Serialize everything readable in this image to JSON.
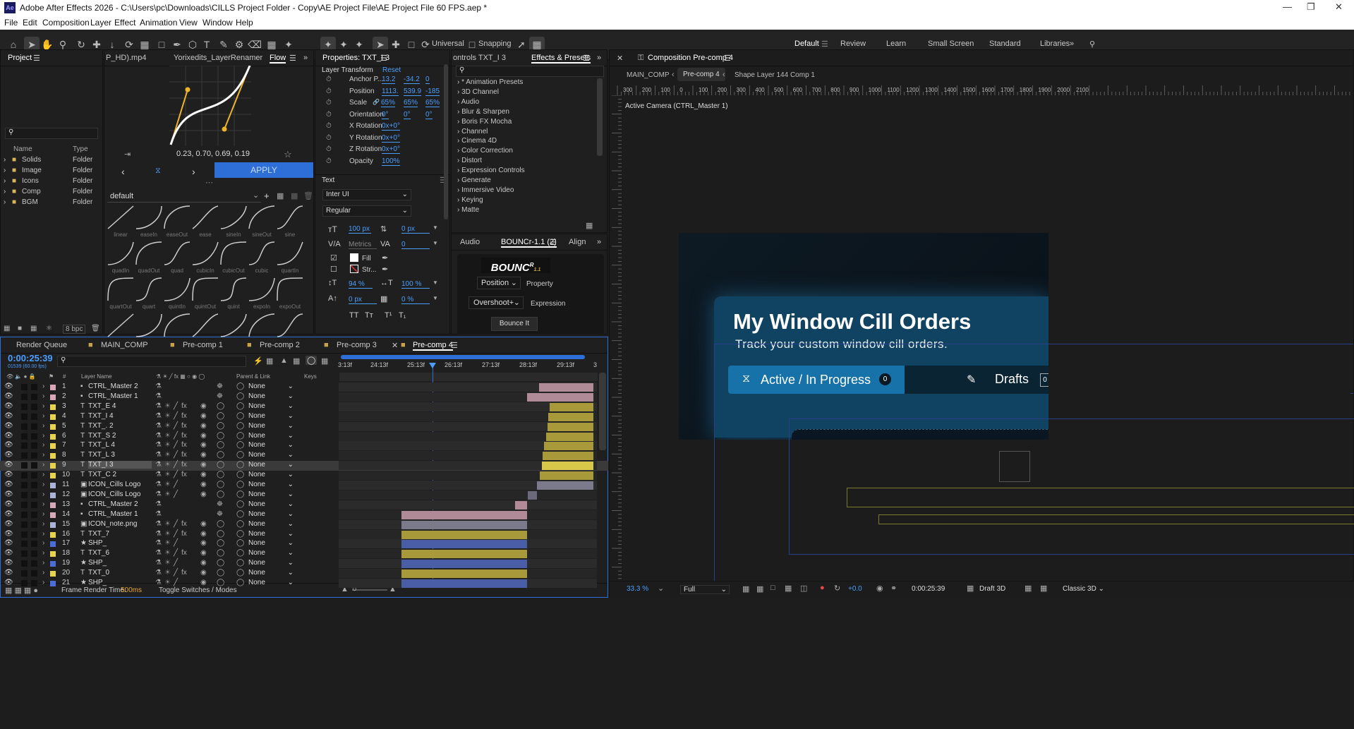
{
  "titlebar": {
    "app_icon": "Ae",
    "title": "Adobe After Effects 2026 - C:\\Users\\pc\\Downloads\\CILLS Project Folder - Copy\\AE Project File\\AE Project File 60 FPS.aep *"
  },
  "menu": [
    "File",
    "Edit",
    "Composition",
    "Layer",
    "Effect",
    "Animation",
    "View",
    "Window",
    "Help"
  ],
  "toolbar": {
    "universal_label": "Universal",
    "snapping_label": "Snapping",
    "workspaces": [
      "Default",
      "Review",
      "Learn",
      "Small Screen",
      "Standard",
      "Libraries"
    ]
  },
  "project": {
    "tab": "Project",
    "col_name": "Name",
    "col_type": "Type",
    "items": [
      {
        "name": "Solids",
        "type": "Folder"
      },
      {
        "name": "Image",
        "type": "Folder"
      },
      {
        "name": "Icons",
        "type": "Folder"
      },
      {
        "name": "Comp",
        "type": "Folder"
      },
      {
        "name": "BGM",
        "type": "Folder"
      }
    ],
    "bpc": "8 bpc"
  },
  "flow": {
    "tabs": [
      "P_HD).mp4",
      "Yorixedits_LayerRenamer",
      "Flow"
    ],
    "values": "0.23, 0.70, 0.69, 0.19",
    "apply": "APPLY",
    "preset": "default",
    "easings": [
      "linear",
      "easeIn",
      "easeOut",
      "ease",
      "sineIn",
      "sineOut",
      "sine",
      "quadIn",
      "quadOut",
      "quad",
      "cubicIn",
      "cubicOut",
      "cubic",
      "quartIn",
      "quartOut",
      "quart",
      "quintIn",
      "quintOut",
      "quint",
      "expoIn",
      "expoOut"
    ]
  },
  "properties": {
    "tab": "Properties: TXT_I 3",
    "section": "Layer Transform",
    "reset": "Reset",
    "rows": [
      {
        "label": "Anchor P...",
        "v1": "13.2",
        "v2": "-34.2",
        "v3": "0"
      },
      {
        "label": "Position",
        "v1": "1113.",
        "v2": "539.9",
        "v3": "-185"
      },
      {
        "label": "Scale",
        "v1": "65%",
        "v2": "65%",
        "v3": "65%"
      },
      {
        "label": "Orientation",
        "v1": "0°",
        "v2": "0°",
        "v3": "0°"
      },
      {
        "label": "X Rotation",
        "v1": "0x+0°",
        "v2": "",
        "v3": ""
      },
      {
        "label": "Y Rotation",
        "v1": "0x+0°",
        "v2": "",
        "v3": ""
      },
      {
        "label": "Z Rotation",
        "v1": "0x+0°",
        "v2": "",
        "v3": ""
      },
      {
        "label": "Opacity",
        "v1": "100%",
        "v2": "",
        "v3": ""
      }
    ],
    "text_section": "Text",
    "font": "Inter UI",
    "style": "Regular",
    "font_size": "100 px",
    "leading": "0 px",
    "kerning": "Metrics",
    "tracking": "0",
    "fill": "Fill",
    "stroke": "Str...",
    "vscale": "94 %",
    "hscale": "100 %",
    "baseline": "0 px",
    "tsume": "0 %",
    "caps": [
      "TT",
      "Tт",
      "T¹",
      "T₁"
    ]
  },
  "effects": {
    "tabs": [
      "ontrols TXT_I 3",
      "Effects & Presets"
    ],
    "items": [
      "* Animation Presets",
      "3D Channel",
      "Audio",
      "Blur & Sharpen",
      "Boris FX Mocha",
      "Channel",
      "Cinema 4D",
      "Color Correction",
      "Distort",
      "Expression Controls",
      "Generate",
      "Immersive Video",
      "Keying",
      "Matte"
    ]
  },
  "bouncr": {
    "tabs": [
      "Audio",
      "BOUNCr-1.1 (2)",
      "Align"
    ],
    "logo": "BOUNC",
    "logo_sup": "R",
    "logo_ver": "1.1",
    "property_select": "Position",
    "property_label": "Property",
    "expression_select": "Overshoot+",
    "expression_label": "Expression",
    "button": "Bounce It"
  },
  "composition": {
    "tab": "Composition Pre-comp 4",
    "breadcrumbs": [
      "MAIN_COMP",
      "Pre-comp 4",
      "Shape Layer 144 Comp 1"
    ],
    "ruler": [
      "300",
      "200",
      "100",
      "0",
      "100",
      "200",
      "300",
      "400",
      "500",
      "600",
      "700",
      "800",
      "900",
      "1000",
      "1100",
      "1200",
      "1300",
      "1400",
      "1500",
      "1600",
      "1700",
      "1800",
      "1900",
      "2000",
      "2100"
    ],
    "camera": "Active Camera (CTRL_Master 1)",
    "card_title": "My Window Cill Orders",
    "card_subtitle": "Track your custom window cill orders.",
    "tab_active": "Active / In Progress",
    "tab_active_count": "0",
    "tab_drafts": "Drafts",
    "tab_drafts_count": "0",
    "zoom": "33.3 %",
    "resolution": "Full",
    "exposure": "+0.0",
    "timecode": "0:00:25:39",
    "renderer": "Draft 3D",
    "view_mode": "Classic 3D"
  },
  "timeline": {
    "tabs": [
      "Render Queue",
      "MAIN_COMP",
      "Pre-comp 1",
      "Pre-comp 2",
      "Pre-comp 3",
      "Pre-comp 4"
    ],
    "timecode": "0:00:25:39",
    "subtime": "01539 (60.00 fps)",
    "col_layer": "Layer Name",
    "col_parent": "Parent & Link",
    "col_keys": "Keys",
    "time_marks": [
      "3:13f",
      "24:13f",
      "25:13f",
      "26:13f",
      "27:13f",
      "28:13f",
      "29:13f",
      "3"
    ],
    "footer_render": "Frame Render Time:",
    "footer_render_value": "500ms",
    "footer_toggle": "Toggle Switches / Modes",
    "layers": [
      {
        "n": "1",
        "name": "CTRL_Master 2",
        "parent": "None"
      },
      {
        "n": "2",
        "name": "CTRL_Master 1",
        "parent": "None"
      },
      {
        "n": "3",
        "name": "TXT_E 4",
        "parent": "None"
      },
      {
        "n": "4",
        "name": "TXT_I 4",
        "parent": "None"
      },
      {
        "n": "5",
        "name": "TXT_. 2",
        "parent": "None"
      },
      {
        "n": "6",
        "name": "TXT_S 2",
        "parent": "None"
      },
      {
        "n": "7",
        "name": "TXT_L 4",
        "parent": "None"
      },
      {
        "n": "8",
        "name": "TXT_L 3",
        "parent": "None"
      },
      {
        "n": "9",
        "name": "TXT_I 3",
        "parent": "None"
      },
      {
        "n": "10",
        "name": "TXT_C 2",
        "parent": "None"
      },
      {
        "n": "11",
        "name": "ICON_Cills Logo",
        "parent": "None"
      },
      {
        "n": "12",
        "name": "ICON_Cills Logo",
        "parent": "None"
      },
      {
        "n": "13",
        "name": "CTRL_Master 2",
        "parent": "None"
      },
      {
        "n": "14",
        "name": "CTRL_Master 1",
        "parent": "None"
      },
      {
        "n": "15",
        "name": "ICON_note.png",
        "parent": "None"
      },
      {
        "n": "16",
        "name": "TXT_7",
        "parent": "None"
      },
      {
        "n": "17",
        "name": "SHP_",
        "parent": "None"
      },
      {
        "n": "18",
        "name": "TXT_6",
        "parent": "None"
      },
      {
        "n": "19",
        "name": "SHP_",
        "parent": "None"
      },
      {
        "n": "20",
        "name": "TXT_0",
        "parent": "None"
      },
      {
        "n": "21",
        "name": "SHP_",
        "parent": "None"
      }
    ]
  },
  "colors": {
    "accent": "#4a9eff",
    "apply_bg": "#2d6fd6",
    "card_bg": "#0e3f5a",
    "bar_pink": "#b08a96",
    "bar_yellow": "#a89a3a",
    "bar_blue": "#4a5ea8"
  }
}
